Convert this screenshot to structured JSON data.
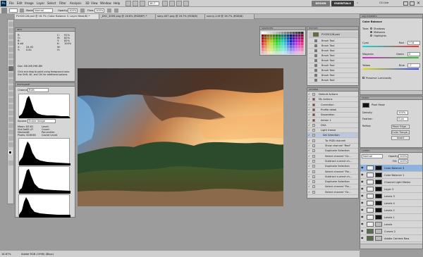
{
  "menu": [
    "File",
    "Edit",
    "Image",
    "Layer",
    "Select",
    "Filter",
    "Analysis",
    "3D",
    "View",
    "Window",
    "Help"
  ],
  "app_logo": "Ps",
  "zoom_display": "16.7",
  "workspaces": {
    "design": "DESIGN",
    "essentials": "ESSENTIALS",
    "cs_live": "CS Live"
  },
  "options": {
    "mode_label": "Mode:",
    "mode_value": "Normal",
    "opacity_label": "Opacity:",
    "opacity_value": "100%",
    "flow_label": "Flow:",
    "flow_value": "100%"
  },
  "tabs": [
    "P1020126.psd @ 16.7% (Color Balance 3, Layer Mask/8) *",
    "_DSC_3009.png @ 16.6% (RGB/8*) *",
    "sony-007.png @ 16.7% (RGB/8)",
    "sunny-1.tif @ 16.7% (RGB/8)"
  ],
  "info_panel": {
    "title": "INFO",
    "rows": [
      [
        "R:",
        "",
        "C:",
        "91%"
      ],
      [
        "G:",
        "",
        "M:",
        "82%"
      ],
      [
        "B:",
        "",
        "Y:",
        "82%"
      ],
      [
        "8-bit",
        "",
        "K:",
        "100%"
      ],
      [
        "X:",
        "24.92",
        "W:",
        ""
      ],
      [
        "Y:",
        "0.81",
        "H:",
        ""
      ]
    ],
    "doc": "Doc: 86.2M/298.8M",
    "hint": "Click and drag to paint using foreground color. Use Shift, Alt, and Ctrl for additional options."
  },
  "histogram_panel": {
    "title": "HISTOGRAM",
    "channel_label": "Channel:",
    "channel_value": "RGB",
    "source_label": "Source:",
    "source_value": "Entire Image",
    "stats": [
      [
        "Mean:",
        "83.81",
        "Level:",
        ""
      ],
      [
        "Std Dev:",
        "69.47",
        "Count:",
        ""
      ],
      [
        "Median:",
        "48",
        "Percentile:",
        ""
      ],
      [
        "Pixels:",
        "328536",
        "Cache Level:",
        "4"
      ]
    ],
    "channels": [
      "Red",
      "Green",
      "Blue"
    ]
  },
  "swatches_panel": {
    "title": "SWATCHES"
  },
  "history_panel": {
    "title": "HISTORY",
    "snapshot": "P1020126.psd",
    "items": [
      "Brush Tool",
      "Brush Tool",
      "Brush Tool",
      "Brush Tool",
      "Brush Tool",
      "Brush Tool",
      "Brush Tool",
      "Brush Tool",
      "Brush Tool"
    ]
  },
  "actions_panel": {
    "title": "ACTIONS",
    "items": [
      "Default Actions",
      "My Actions",
      "Correction",
      "Profile detail",
      "Separation",
      "Action 1",
      "DSA",
      "Light freeze",
      "Set Selection",
      "To: RGB channel",
      "Show channel \"Red\"",
      "Duplicate Selection",
      "Select channel \"Gr...",
      "Subtract current ch...",
      "Duplicate Selection",
      "Select channel \"Re...",
      "Subtract current ch...",
      "Duplicate Selection",
      "Select channel \"Re...",
      "Select channel \"Gr..."
    ]
  },
  "adjustments_panel": {
    "title": "ADJUSTMENTS",
    "subtitle": "Color Balance",
    "tone_label": "Tone:",
    "tones": [
      "Shadows",
      "Midtones",
      "Highlights"
    ],
    "sliders": [
      {
        "left": "Cyan",
        "right": "Red",
        "value": "+14"
      },
      {
        "left": "Magenta",
        "right": "Green",
        "value": "0"
      },
      {
        "left": "Yellow",
        "right": "Blue",
        "value": "-7"
      }
    ],
    "preserve": "Preserve Luminosity"
  },
  "masks_panel": {
    "title": "MASKS",
    "type": "Pixel Mask",
    "density_label": "Density:",
    "density_value": "100%",
    "feather_label": "Feather:",
    "feather_value": "0 px",
    "refine_label": "Refine:",
    "buttons": [
      "Mask Edge...",
      "Color Range...",
      "Invert"
    ]
  },
  "layers_panel": {
    "title": "LAYERS",
    "blend": "Normal",
    "opacity_label": "Opacity:",
    "opacity_value": "100%",
    "fill_label": "Fill:",
    "fill_value": "100%",
    "layers": [
      "Color Balance 3",
      "Color Balance 1",
      "Channel Light Masks",
      "Layer 3",
      "Levels 3",
      "Levels 4",
      "Levels 2",
      "Levels 1",
      "Levels",
      "Curves 2",
      "Adobe Camera Raw"
    ]
  },
  "status": {
    "zoom": "16.67%",
    "doc": "Adobe RGB (1998) (8bpc)"
  },
  "colors": {
    "accent": "#2b6fc3",
    "workspace": "#9c9c9c"
  }
}
